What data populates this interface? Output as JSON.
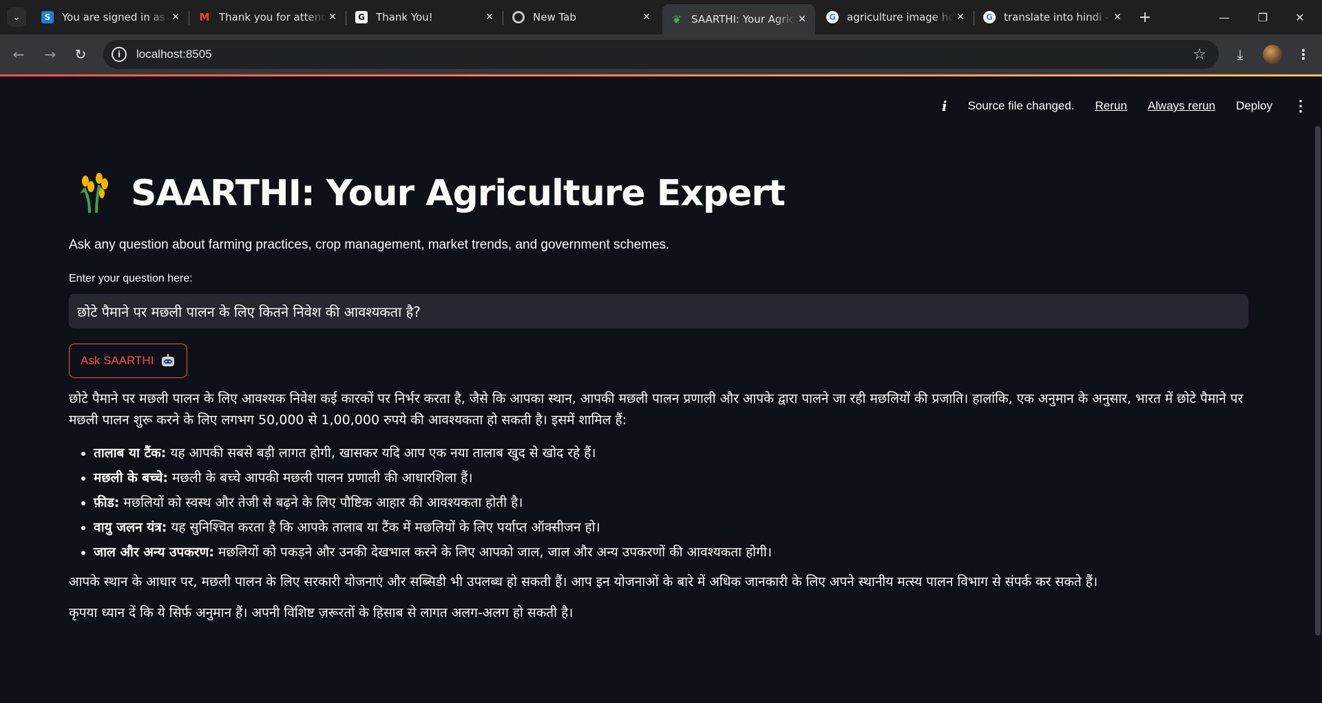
{
  "browser": {
    "tabs": [
      {
        "title": "You are signed in as t",
        "icon": "slack-s-icon",
        "active": false
      },
      {
        "title": "Thank you for attendi",
        "icon": "gmail-icon",
        "active": false
      },
      {
        "title": "Thank You!",
        "icon": "grammarly-g-icon",
        "active": false
      },
      {
        "title": "New Tab",
        "icon": "chrome-icon",
        "active": false
      },
      {
        "title": "SAARTHI: Your Agricu",
        "icon": "sprout-icon",
        "active": true
      },
      {
        "title": "agriculture image hd",
        "icon": "google-icon",
        "active": false
      },
      {
        "title": "translate into hindi -",
        "icon": "google-icon",
        "active": false
      }
    ],
    "url": "localhost:8505"
  },
  "streamlit_header": {
    "status": "Source file changed.",
    "rerun": "Rerun",
    "always_rerun": "Always rerun",
    "deploy": "Deploy"
  },
  "main": {
    "title": "SAARTHI: Your Agriculture Expert",
    "subtitle": "Ask any question about farming practices, crop management, market trends, and government schemes.",
    "input_label": "Enter your question here:",
    "input_value": "छोटे पैमाने पर मछली पालन के लिए कितने निवेश की आवश्यकता है?",
    "ask_button": "Ask SAARTHI",
    "answer_intro": "छोटे पैमाने पर मछली पालन के लिए आवश्यक निवेश कई कारकों पर निर्भर करता है, जैसे कि आपका स्थान, आपकी मछली पालन प्रणाली और आपके द्वारा पालने जा रही मछलियों की प्रजाति। हालांकि, एक अनुमान के अनुसार, भारत में छोटे पैमाने पर मछली पालन शुरू करने के लिए लगभग 50,000 से 1,00,000 रुपये की आवश्यकता हो सकती है। इसमें शामिल हैं:",
    "answer_items": [
      {
        "term": "तालाब या टैंक:",
        "text": " यह आपकी सबसे बड़ी लागत होगी, खासकर यदि आप एक नया तालाब खुद से खोद रहे हैं।"
      },
      {
        "term": "मछली के बच्चे:",
        "text": " मछली के बच्चे आपकी मछली पालन प्रणाली की आधारशिला हैं।"
      },
      {
        "term": "फ़ीड:",
        "text": " मछलियों को स्वस्थ और तेजी से बढ़ने के लिए पौष्टिक आहार की आवश्यकता होती है।"
      },
      {
        "term": "वायु जलन यंत्र:",
        "text": " यह सुनिश्चित करता है कि आपके तालाब या टैंक में मछलियों के लिए पर्याप्त ऑक्सीजन हो।"
      },
      {
        "term": "जाल और अन्य उपकरण:",
        "text": " मछलियों को पकड़ने और उनकी देखभाल करने के लिए आपको जाल, जाल और अन्य उपकरणों की आवश्यकता होगी।"
      }
    ],
    "answer_para2": "आपके स्थान के आधार पर, मछली पालन के लिए सरकारी योजनाएं और सब्सिडी भी उपलब्ध हो सकती हैं। आप इन योजनाओं के बारे में अधिक जानकारी के लिए अपने स्थानीय मत्स्य पालन विभाग से संपर्क कर सकते हैं।",
    "answer_para3": "कृपया ध्यान दें कि ये सिर्फ अनुमान हैं। अपनी विशिष्ट ज़रूरतों के हिसाब से लागत अलग-अलग हो सकती है।"
  },
  "colors": {
    "app_bg": "#0e1117",
    "accent": "#ff4b4b",
    "input_bg": "#262730"
  }
}
